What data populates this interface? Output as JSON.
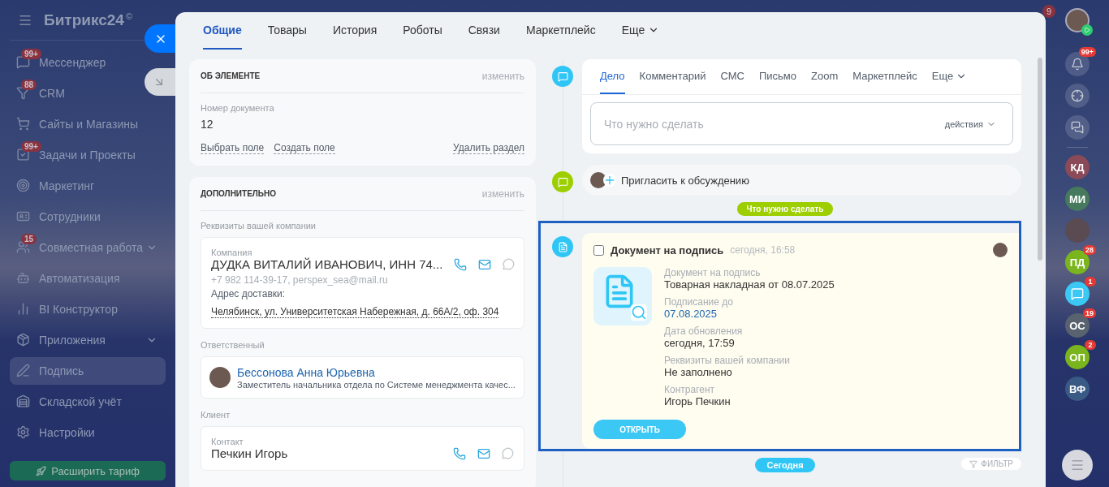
{
  "sidebar": {
    "logo": "Битрикс24",
    "logo_mark": "©",
    "items": [
      {
        "label": "Мессенджер",
        "badge": "99+",
        "has_submenu": false,
        "selected": false
      },
      {
        "label": "CRM",
        "badge": "88",
        "has_submenu": false,
        "selected": false
      },
      {
        "label": "Сайты и Магазины",
        "has_submenu": false,
        "selected": false
      },
      {
        "label": "Задачи и Проекты",
        "badge": "99+",
        "has_submenu": false,
        "selected": false
      },
      {
        "label": "Маркетинг",
        "has_submenu": false,
        "selected": false
      },
      {
        "label": "Сотрудники",
        "has_submenu": false,
        "selected": false
      },
      {
        "label": "Совместная работа",
        "badge": "15",
        "has_submenu": true,
        "selected": false
      },
      {
        "label": "Автоматизация",
        "has_submenu": false,
        "selected": false
      },
      {
        "label": "BI Конструктор",
        "has_submenu": false,
        "selected": false
      },
      {
        "label": "Приложения",
        "has_submenu": true,
        "selected": false
      },
      {
        "label": "Подпись",
        "has_submenu": false,
        "selected": true
      },
      {
        "label": "Складской учёт",
        "has_submenu": false,
        "selected": false
      },
      {
        "label": "Настройки",
        "has_submenu": false,
        "selected": false
      }
    ],
    "upgrade_button": "Расширить тариф"
  },
  "tabs": [
    {
      "label": "Общие",
      "selected": true,
      "dropdown": false
    },
    {
      "label": "Товары",
      "selected": false,
      "dropdown": false
    },
    {
      "label": "История",
      "selected": false,
      "dropdown": false
    },
    {
      "label": "Роботы",
      "selected": false,
      "dropdown": false
    },
    {
      "label": "Связи",
      "selected": false,
      "dropdown": false
    },
    {
      "label": "Маркетплейс",
      "selected": false,
      "dropdown": false
    },
    {
      "label": "Еще",
      "selected": false,
      "dropdown": true
    }
  ],
  "about": {
    "title": "ОБ ЭЛЕМЕНТЕ",
    "edit": "изменить",
    "field_label": "Номер документа",
    "field_value": "12",
    "links": [
      "Выбрать поле",
      "Создать поле"
    ],
    "delete_link": "Удалить раздел"
  },
  "extra": {
    "title": "ДОПОЛНИТЕЛЬНО",
    "edit": "изменить",
    "company_section": "Реквизиты вашей компании",
    "company": {
      "label": "Компания",
      "name": "ДУДКА ВИТАЛИЙ ИВАНОВИЧ, ИНН 74...",
      "contacts": "+7 982 114-39-17, perspex_sea@mail.ru",
      "address_label": "Адрес доставки:",
      "address": "Челябинск, ул. Университетская Набережная, д. 66А/2, оф. 304"
    },
    "responsible_section": "Ответственный",
    "responsible": {
      "name": "Бессонова Анна Юрьевна",
      "position": "Заместитель начальника отдела по Системе менеджмента качес..."
    },
    "client_section": "Клиент",
    "client": {
      "label": "Контакт",
      "name": "Печкин Игорь"
    }
  },
  "composer": {
    "tabs": [
      {
        "label": "Дело",
        "selected": true,
        "dropdown": false
      },
      {
        "label": "Комментарий",
        "selected": false,
        "dropdown": false
      },
      {
        "label": "СМС",
        "selected": false,
        "dropdown": false
      },
      {
        "label": "Письмо",
        "selected": false,
        "dropdown": false
      },
      {
        "label": "Zoom",
        "selected": false,
        "dropdown": false
      },
      {
        "label": "Маркетплейс",
        "selected": false,
        "dropdown": false
      },
      {
        "label": "Еще",
        "selected": false,
        "dropdown": true
      }
    ],
    "placeholder": "Что нужно сделать",
    "actions": "действия"
  },
  "invite": "Пригласить к обсуждению",
  "section_label": "Что нужно сделать",
  "activity": {
    "title": "Документ на подпись",
    "time": "сегодня, 16:58",
    "checked": false,
    "fields": [
      {
        "label": "Документ на подпись",
        "value": "Товарная накладная от 08.07.2025",
        "kind": "text"
      },
      {
        "label": "Подписание до",
        "value": "07.08.2025",
        "kind": "link"
      },
      {
        "label": "Дата обновления",
        "value": "сегодня, 17:59",
        "kind": "text"
      },
      {
        "label": "Реквизиты вашей компании",
        "value": "Не заполнено",
        "kind": "text"
      },
      {
        "label": "Контрагент",
        "value": "Игорь Печкин",
        "kind": "text"
      }
    ],
    "button": "ОТКРЫТЬ"
  },
  "today_label": "Сегодня",
  "filter": "ФИЛЬТР",
  "rightbar": {
    "counter": "9",
    "tools": [
      {
        "kind": "bell",
        "badge": "99+"
      },
      {
        "kind": "target"
      },
      {
        "kind": "chat"
      }
    ],
    "contacts": [
      {
        "kind": "initials",
        "text": "КД",
        "color": "#8a4a58"
      },
      {
        "kind": "initials",
        "text": "МИ",
        "color": "#46795d"
      },
      {
        "kind": "photo"
      },
      {
        "kind": "initials",
        "text": "ПД",
        "color": "#7ab51d",
        "badge": "28"
      },
      {
        "kind": "chat",
        "badge": "1"
      },
      {
        "kind": "initials",
        "text": "ОС",
        "color": "#58636f",
        "badge": "19"
      },
      {
        "kind": "initials",
        "text": "ОП",
        "color": "#7ab51d",
        "badge": "2"
      },
      {
        "kind": "initials",
        "text": "ВФ",
        "color": "#3a5a86"
      }
    ]
  }
}
